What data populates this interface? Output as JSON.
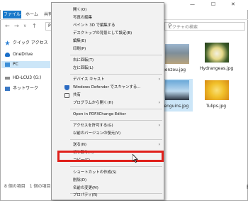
{
  "titlebar": {
    "min": "—",
    "max": "☐",
    "close": "✕"
  },
  "ribbon": {
    "file": "ファイル",
    "home": "ホーム",
    "share": "共有"
  },
  "address": {
    "path": "PC",
    "search_placeholder": "ピクチャの検索"
  },
  "sidebar": {
    "items": [
      {
        "label": "クイック アクセス"
      },
      {
        "label": "OneDrive"
      },
      {
        "label": "PC"
      },
      {
        "label": "HD-LCU3 (G:)"
      },
      {
        "label": "ネットワーク"
      }
    ]
  },
  "files": [
    {
      "name": "genzou.jpg"
    },
    {
      "name": "Hydrangeas.jpg"
    },
    {
      "name": "Penguins.jpg"
    },
    {
      "name": "Tulips.jpg"
    }
  ],
  "status": {
    "text": "8 個の項目　1 個の項目を選択"
  },
  "menu": {
    "items": [
      "開く(O)",
      "写真の編集",
      "ペイント 3D で編集する",
      "デスクトップの背景として設定(B)",
      "編集(E)",
      "印刷(P)",
      "右に回転(T)",
      "左に回転(L)",
      "デバイス キャスト",
      "Windows Defender でスキャンする...",
      "共有",
      "プログラムから開く(H)",
      "Open in PDFXChange Editor",
      "アクセスを許可する(G)",
      "以前のバージョンの復元(V)",
      "送る(N)",
      "切り取り(T)",
      "コピー(C)",
      "ショートカットの作成(S)",
      "削除(D)",
      "名前の変更(M)",
      "プロパティ(R)"
    ]
  },
  "colors": {
    "file_tab": "#1979ca",
    "highlight": "#e0201b",
    "selection": "#cce6f8"
  }
}
